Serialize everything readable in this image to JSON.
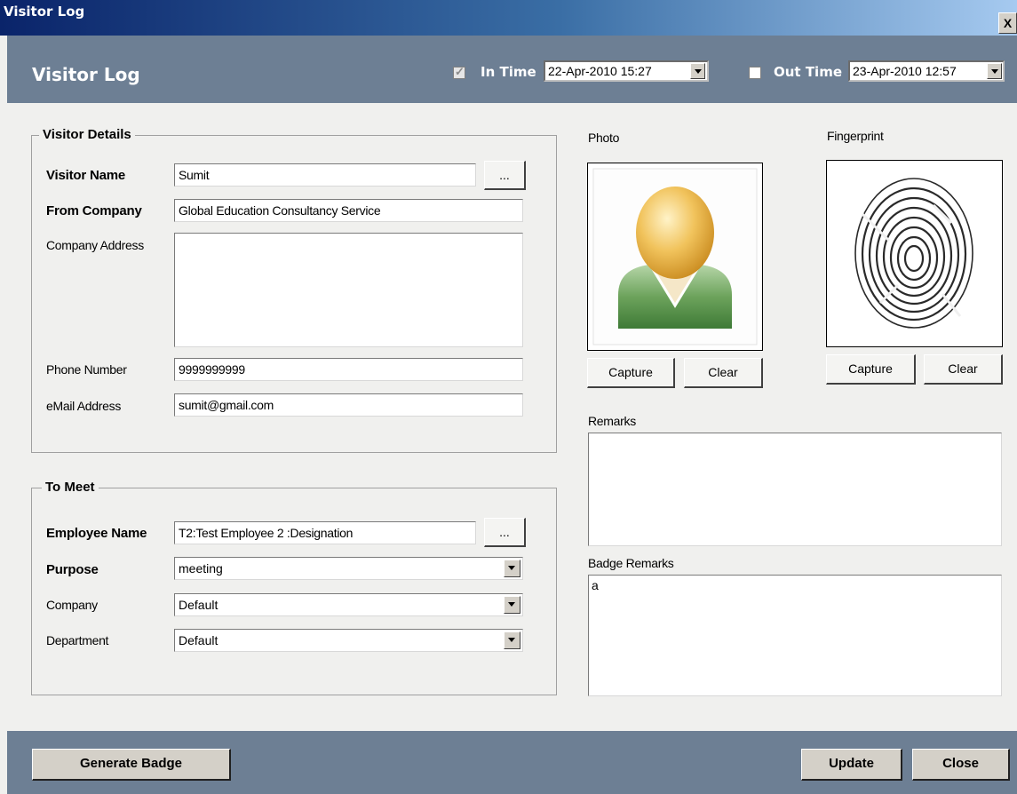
{
  "window": {
    "title": "Visitor Log",
    "close_glyph": "X"
  },
  "header": {
    "title": "Visitor Log",
    "in_time": {
      "label": "In Time",
      "checked": true,
      "value": "22-Apr-2010 15:27"
    },
    "out_time": {
      "label": "Out Time",
      "checked": false,
      "value": "23-Apr-2010 12:57"
    }
  },
  "visitor_details": {
    "legend": "Visitor Details",
    "visitor_name": {
      "label": "Visitor Name",
      "value": "Sumit",
      "browse": "..."
    },
    "from_company": {
      "label": "From Company",
      "value": "Global Education Consultancy Service"
    },
    "company_address": {
      "label": "Company Address",
      "value": ""
    },
    "phone": {
      "label": "Phone Number",
      "value": "9999999999"
    },
    "email": {
      "label": "eMail Address",
      "value": "sumit@gmail.com"
    }
  },
  "to_meet": {
    "legend": "To Meet",
    "employee_name": {
      "label": "Employee Name",
      "value": "T2:Test Employee 2 :Designation",
      "browse": "..."
    },
    "purpose": {
      "label": "Purpose",
      "value": "meeting"
    },
    "company": {
      "label": "Company",
      "value": "Default"
    },
    "department": {
      "label": "Department",
      "value": "Default"
    }
  },
  "photo": {
    "label": "Photo",
    "capture": "Capture",
    "clear": "Clear",
    "icon": "user-avatar-icon"
  },
  "fingerprint": {
    "label": "Fingerprint",
    "capture": "Capture",
    "clear": "Clear",
    "icon": "fingerprint-icon"
  },
  "remarks": {
    "label": "Remarks",
    "value": ""
  },
  "badge_remarks": {
    "label": "Badge Remarks",
    "value": "a"
  },
  "footer": {
    "generate_badge": "Generate Badge",
    "update": "Update",
    "close": "Close"
  }
}
